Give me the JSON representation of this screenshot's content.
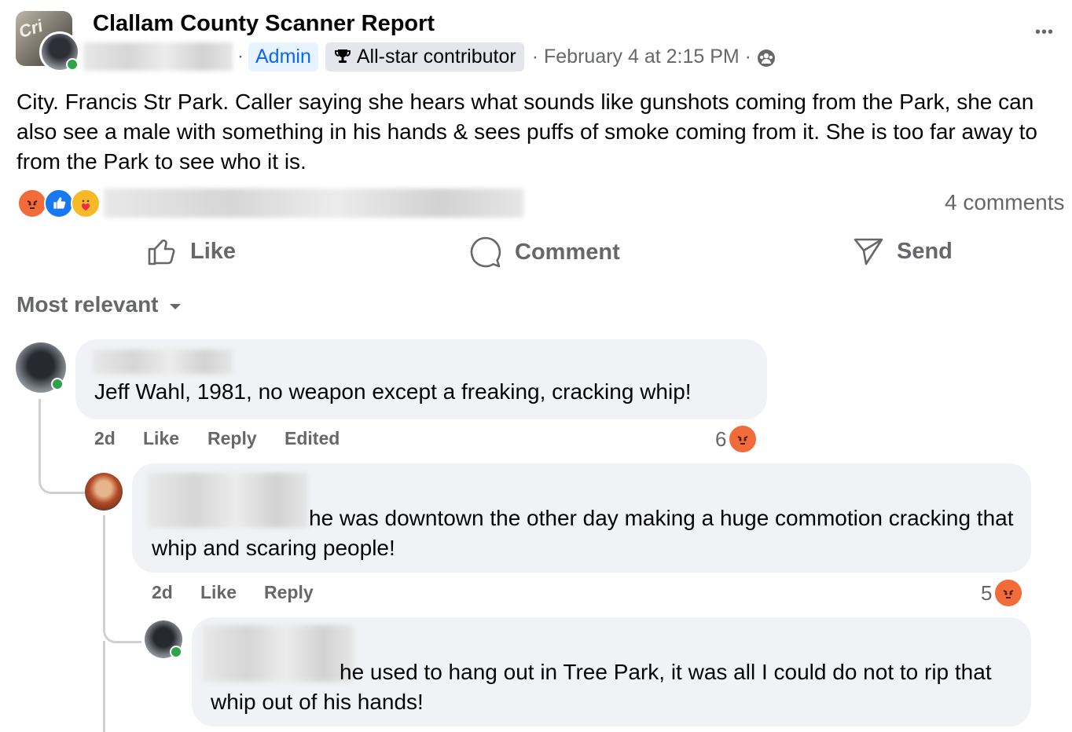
{
  "post": {
    "group_name": "Clallam County Scanner Report",
    "avatar_badge_text": "Cri",
    "separator_dot": "·",
    "role_badge": "Admin",
    "contributor_badge": "All-star contributor",
    "timestamp": "· February 4 at 2:15 PM ·",
    "more_icon": "•••",
    "body": "City. Francis Str Park.  Caller saying she hears what sounds like gunshots coming from the Park, she can also see a male with something in his hands & sees puffs of smoke coming from it. She is too far away to  from the Park to see who it is.",
    "reactions": [
      "angry",
      "like",
      "care"
    ],
    "comments_count": "4 comments"
  },
  "actions": {
    "like": "Like",
    "comment": "Comment",
    "send": "Send"
  },
  "sort": {
    "label": "Most relevant"
  },
  "comments": [
    {
      "text": "Jeff Wahl, 1981, no weapon except a freaking, cracking whip!",
      "age": "2d",
      "like": "Like",
      "reply": "Reply",
      "edited": "Edited",
      "reaction_count": "6",
      "reaction": "angry"
    },
    {
      "text": "he was downtown the other day making a huge commotion cracking that whip and scaring people!",
      "age": "2d",
      "like": "Like",
      "reply": "Reply",
      "reaction_count": "5",
      "reaction": "angry"
    },
    {
      "text": "he used to hang out in Tree Park, it was all I could do not to rip that whip out of his hands!"
    }
  ],
  "colors": {
    "angry": "#f26b3a",
    "like": "#1877f2",
    "care": "#f7b928",
    "online": "#31a24c",
    "admin_bg": "#e7f3ff",
    "admin_text": "#0866ff",
    "meta_gray": "#65676b",
    "bubble_bg": "#f0f2f5"
  }
}
